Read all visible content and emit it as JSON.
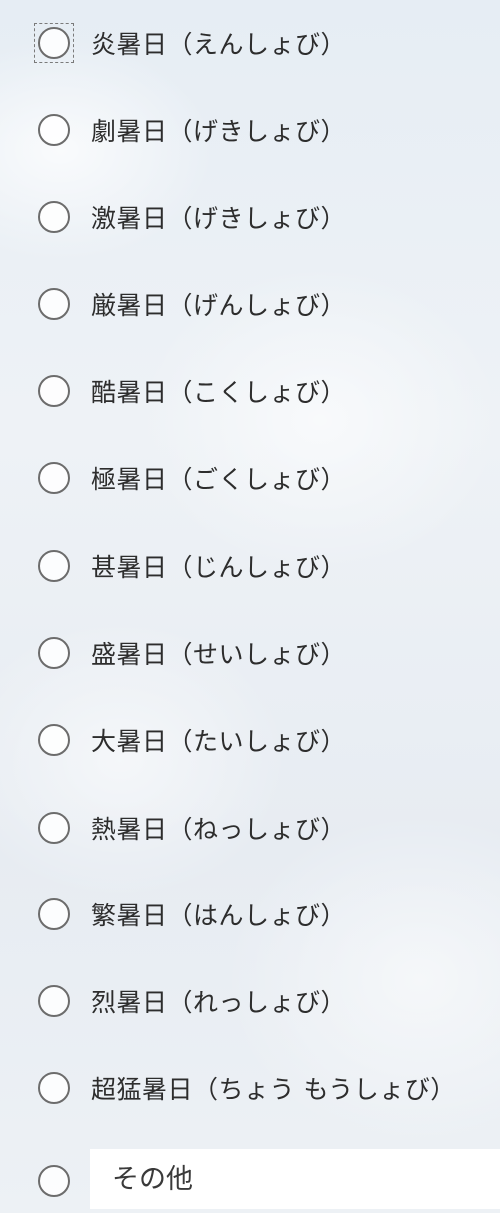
{
  "options": [
    {
      "label": "炎暑日（えんしょび）"
    },
    {
      "label": "劇暑日（げきしょび）"
    },
    {
      "label": "激暑日（げきしょび）"
    },
    {
      "label": "厳暑日（げんしょび）"
    },
    {
      "label": "酷暑日（こくしょび）"
    },
    {
      "label": "極暑日（ごくしょび）"
    },
    {
      "label": "甚暑日（じんしょび）"
    },
    {
      "label": "盛暑日（せいしょび）"
    },
    {
      "label": "大暑日（たいしょび）"
    },
    {
      "label": "熱暑日（ねっしょび）"
    },
    {
      "label": "繁暑日（はんしょび）"
    },
    {
      "label": "烈暑日（れっしょび）"
    },
    {
      "label": "超猛暑日（ちょう もうしょび）"
    }
  ],
  "other": {
    "placeholder": "その他",
    "value": ""
  }
}
